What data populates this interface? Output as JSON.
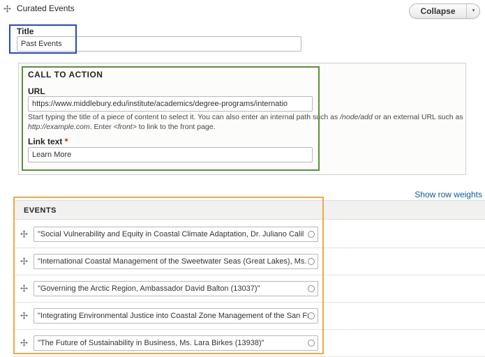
{
  "paragraph": {
    "title": "Curated Events",
    "collapse_label": "Collapse",
    "dropdown_glyph": "▾"
  },
  "title_field": {
    "label": "Title",
    "value": "Past Events"
  },
  "cta": {
    "legend": "CALL TO ACTION",
    "url_label": "URL",
    "url_value": "https://www.middlebury.edu/institute/academics/degree-programs/internatio",
    "url_desc_1": "Start typing the title of a piece of content to select it. You can also enter an internal path such as ",
    "url_desc_path": "/node/add",
    "url_desc_2": " or an external URL such as ",
    "url_desc_example": "http://example.com",
    "url_desc_3": ". Enter ",
    "url_desc_front": "<front>",
    "url_desc_4": " to link to the front page.",
    "link_text_label": "Link text",
    "required_mark": "*",
    "link_text_value": "Learn More"
  },
  "events": {
    "show_row_weights": "Show row weights",
    "header": "EVENTS",
    "rows": [
      "\"Social Vulnerability and Equity in Coastal Climate Adaptation, Dr. Juliano Calil",
      "\"International Coastal Management of the Sweetwater Seas (Great Lakes), Ms. R",
      "\"Governing the Arctic Region, Ambassador David Balton (13037)\"",
      "\"Integrating Environmental Justice into Coastal Zone Management of the San Fr",
      "\"The Future of Sustainability in Business, Ms. Lara Birkes (13938)\""
    ]
  },
  "colors": {
    "highlight_title": "#2547c8",
    "highlight_cta": "#5a8f3b",
    "highlight_events": "#f0a844",
    "link": "#0a5ba6"
  },
  "icons": {
    "drag": "move-icon",
    "dropdown": "chevron-down-icon",
    "autocomplete": "autocomplete-throbber-icon"
  }
}
